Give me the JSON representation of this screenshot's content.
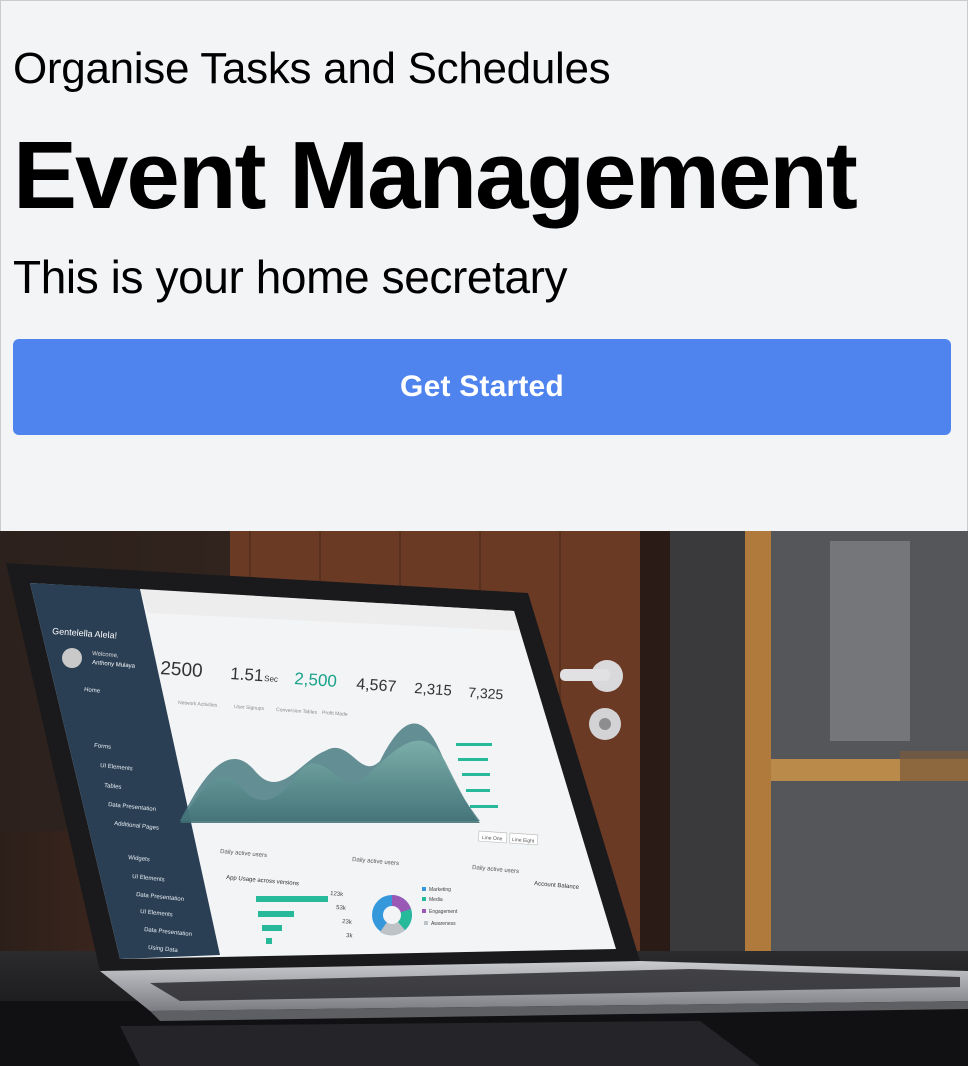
{
  "hero": {
    "eyebrow": "Organise Tasks and Schedules",
    "headline": "Event Management",
    "tagline": "This is your home secretary",
    "cta_label": "Get Started"
  },
  "photo": {
    "description_icon": "laptop-dashboard-photo",
    "screen": {
      "brand": "Gentelella Alela!",
      "welcome": "Welcome,",
      "user": "Anthony Mulaya",
      "stats": [
        {
          "label": "Total Users",
          "value": "2500"
        },
        {
          "label": "Average Time",
          "value": "1.51"
        },
        {
          "label": "Total Males",
          "value": "2,500"
        },
        {
          "label": "Total Females",
          "value": "4,567"
        },
        {
          "label": "Total Collections",
          "value": "2,315"
        },
        {
          "label": "Total Connections",
          "value": "7,325"
        }
      ],
      "stat_unit": "Sec",
      "nav": [
        "Home",
        "Forms",
        "UI Elements",
        "Tables",
        "Data Presentation",
        "Additional Pages"
      ],
      "tabs": [
        "Network Activities",
        "User Signups",
        "Conversion Tables",
        "Profit Made"
      ],
      "panels": [
        "Daily active users",
        "Daily active users",
        "Daily active users"
      ],
      "app_usage_title": "App Usage across versions",
      "app_usage_values": [
        "123k",
        "53k",
        "23k",
        "3k"
      ],
      "legend": [
        "Marketing",
        "Media",
        "Engagement",
        "Awareness"
      ],
      "buttons": [
        "Line One",
        "Line Eight"
      ],
      "account_title": "Account Balance"
    }
  }
}
